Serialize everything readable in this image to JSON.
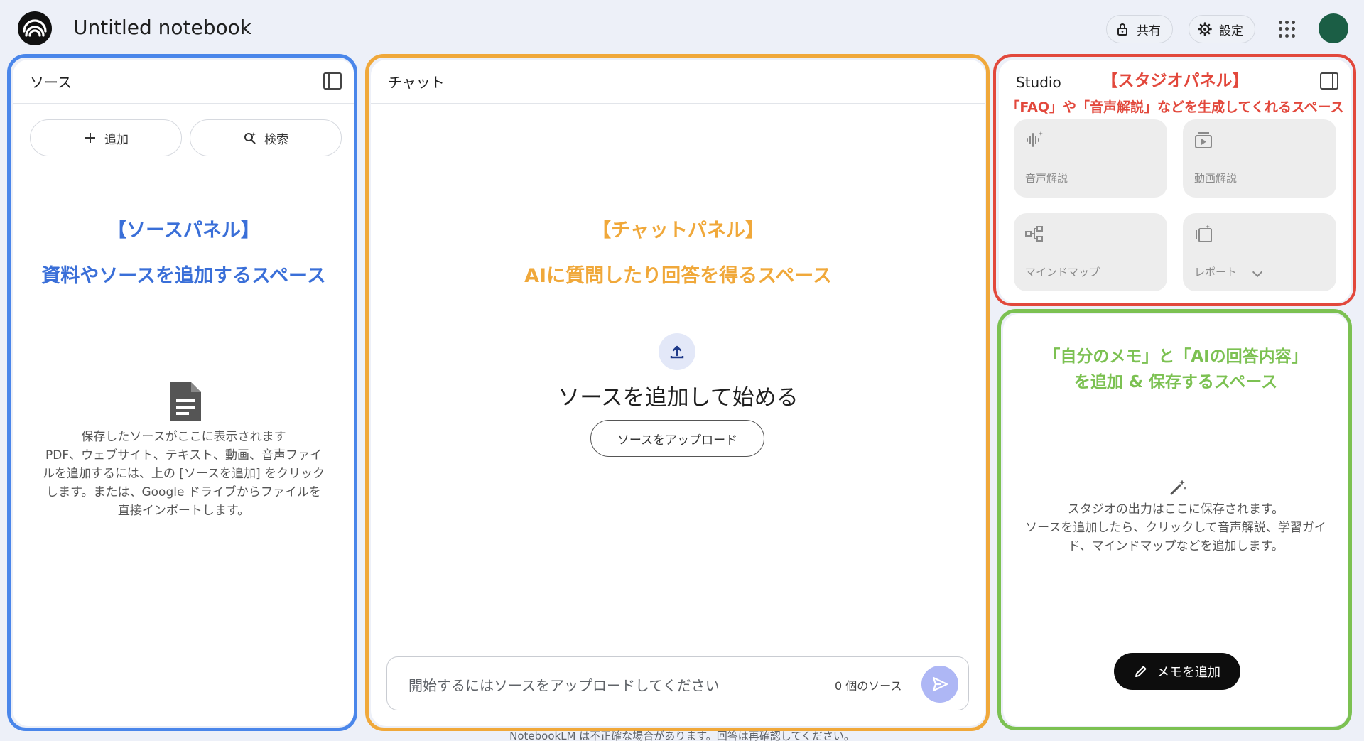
{
  "header": {
    "title": "Untitled notebook",
    "share_label": "共有",
    "settings_label": "設定"
  },
  "source_panel": {
    "title": "ソース",
    "add_label": "追加",
    "search_label": "検索",
    "annotation_title": "【ソースパネル】",
    "annotation_desc": "資料やソースを追加するスペース",
    "empty_title": "保存したソースがここに表示されます",
    "empty_lines": [
      "PDF、ウェブサイト、テキスト、動画、音声ファイ",
      "ルを追加するには、上の [ソースを追加] をクリック",
      "します。または、Google ドライブからファイルを",
      "直接インポートします。"
    ]
  },
  "chat_panel": {
    "title": "チャット",
    "annotation_title": "【チャットパネル】",
    "annotation_desc": "AIに質問したり回答を得るスペース",
    "start_text": "ソースを追加して始める",
    "upload_label": "ソースをアップロード",
    "input_placeholder": "開始するにはソースをアップロードしてください",
    "source_count": "0 個のソース"
  },
  "studio_panel": {
    "title": "Studio",
    "annotation_title": "【スタジオパネル】",
    "annotation_desc": "「FAQ」や「音声解説」などを生成してくれるスペース",
    "tiles": [
      {
        "label": "音声解説",
        "icon": "audio-waveform-icon"
      },
      {
        "label": "動画解説",
        "icon": "video-icon"
      },
      {
        "label": "マインドマップ",
        "icon": "mind-map-icon"
      },
      {
        "label": "レポート",
        "icon": "report-icon"
      }
    ]
  },
  "notes_panel": {
    "annotation_line1": "「自分のメモ」と「AIの回答内容」",
    "annotation_line2": "を追加 & 保存するスペース",
    "empty_lines": [
      "スタジオの出力はここに保存されます。",
      "ソースを追加したら、クリックして音声解説、学習ガイ",
      "ド、マインドマップなどを追加します。"
    ],
    "add_memo_label": "メモを追加"
  },
  "footer": {
    "note": "NotebookLM は不正確な場合があります。回答は再確認してください。"
  },
  "colors": {
    "source_frame": "#4a86ea",
    "chat_frame": "#f0a83a",
    "studio_frame": "#e2483c",
    "notes_frame": "#7cc152",
    "send_button": "#aeb7f5",
    "avatar": "#1b5e45"
  }
}
